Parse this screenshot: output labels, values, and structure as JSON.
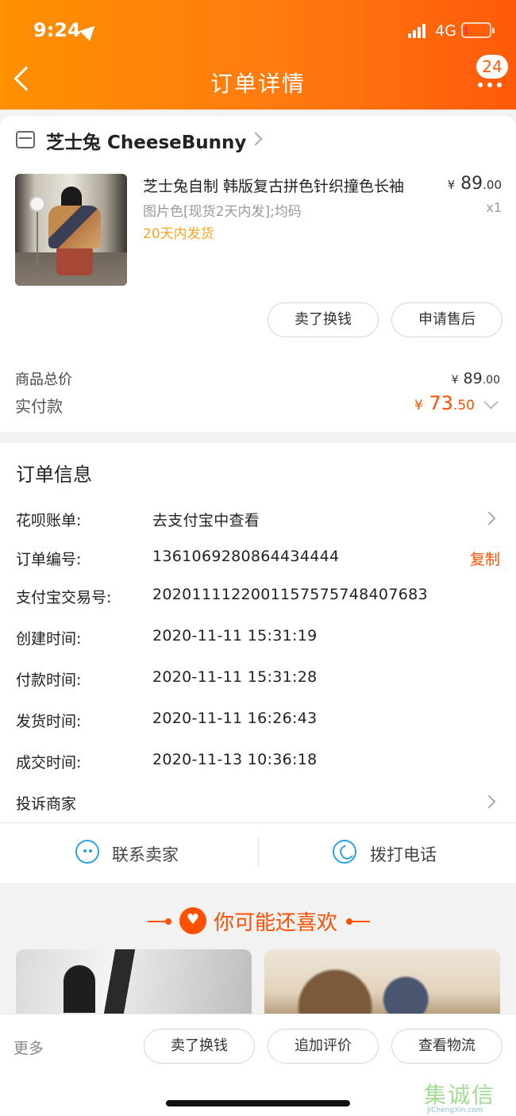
{
  "status_bar": {
    "time": "9:24",
    "network": "4G"
  },
  "nav": {
    "title": "订单详情",
    "badge_count": "24"
  },
  "shop": {
    "name": "芝士兔 CheeseBunny"
  },
  "product": {
    "title": "芝士兔自制 韩版复古拼色针织撞色长袖",
    "sku": "图片色[现货2天内发];均码",
    "shipping_note": "20天内发货",
    "price_symbol": "¥",
    "price_int": "89",
    "price_cents": ".00",
    "quantity": "x1"
  },
  "product_actions": {
    "sell_label": "卖了换钱",
    "after_sale_label": "申请售后"
  },
  "summary": {
    "total_label": "商品总价",
    "total_symbol": "¥",
    "total_int": "89",
    "total_cents": ".00",
    "paid_label": "实付款",
    "paid_symbol": "¥",
    "paid_int": "73",
    "paid_cents": ".50"
  },
  "order_info": {
    "title": "订单信息",
    "huabei_label": "花呗账单:",
    "huabei_value": "去支付宝中查看",
    "order_no_label": "订单编号:",
    "order_no_value": "1361069280864434444",
    "copy_label": "复制",
    "alipay_label": "支付宝交易号:",
    "alipay_value": "2020111122001157575748407683",
    "created_label": "创建时间:",
    "created_value": "2020-11-11 15:31:19",
    "paid_label": "付款时间:",
    "paid_value": "2020-11-11 15:31:28",
    "shipped_label": "发货时间:",
    "shipped_value": "2020-11-11 16:26:43",
    "closed_label": "成交时间:",
    "closed_value": "2020-11-13 10:36:18",
    "complaint_label": "投诉商家"
  },
  "contact": {
    "seller_label": "联系卖家",
    "call_label": "拨打电话"
  },
  "recommend": {
    "title": "你可能还喜欢"
  },
  "bottom_bar": {
    "more_label": "更多",
    "sell_label": "卖了换钱",
    "review_label": "追加评价",
    "logistics_label": "查看物流"
  },
  "watermark": {
    "cn": "集诚信",
    "en": "JiChengXin.com"
  },
  "colors": {
    "header_start": "#ff9000",
    "header_end": "#ff5a0a",
    "accent": "#ff5000",
    "shipping": "#f5a623",
    "icon_blue": "#29a3e0"
  }
}
